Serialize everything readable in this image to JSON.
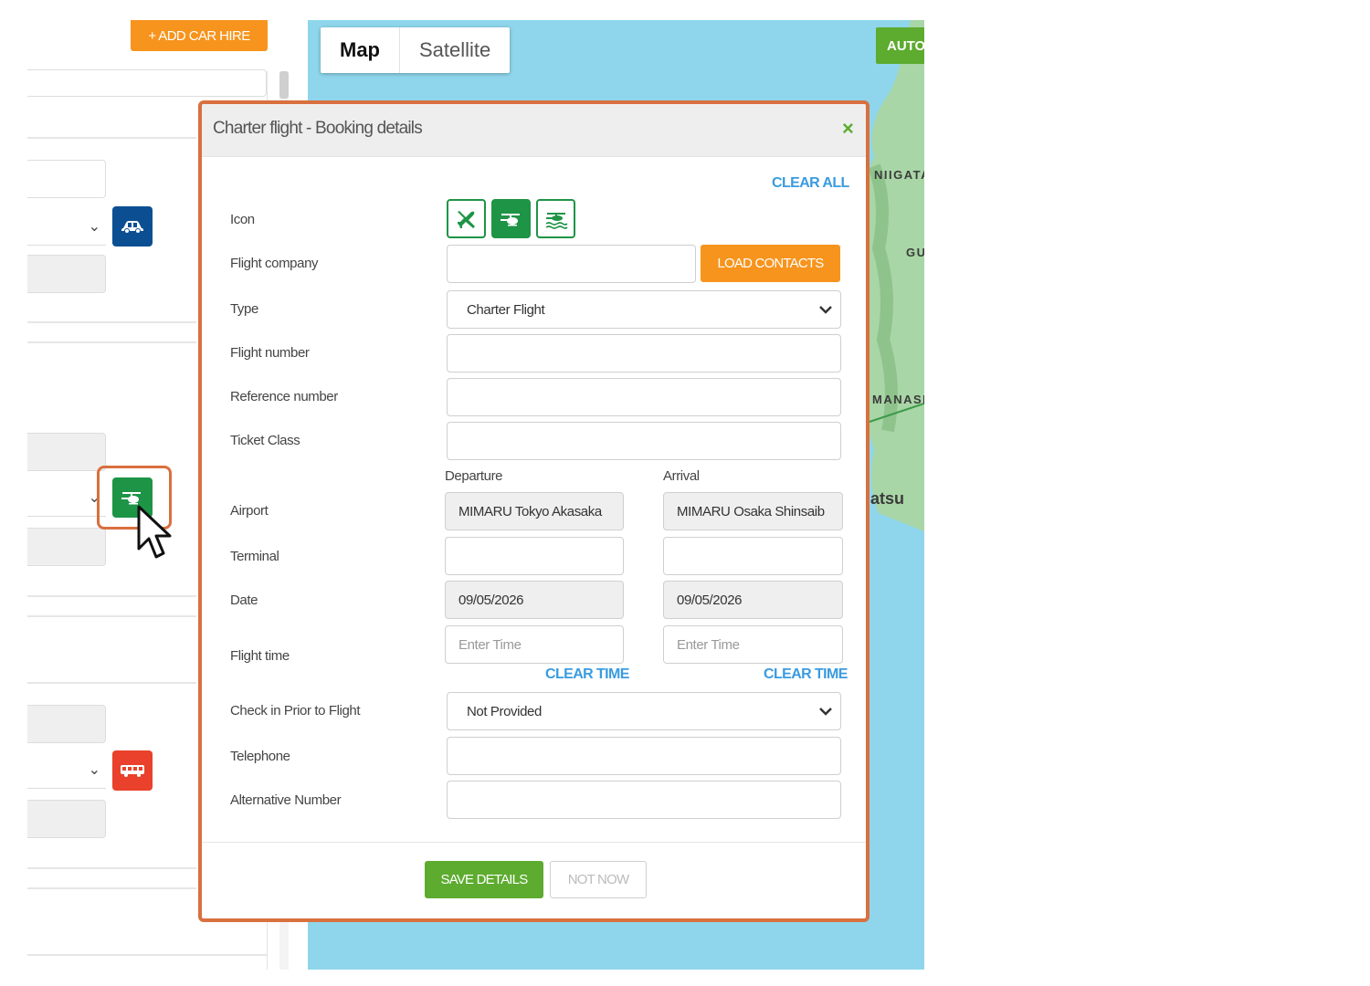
{
  "left_panel": {
    "add_car_hire_label": "+ ADD CAR HIRE"
  },
  "map": {
    "tabs": [
      {
        "label": "Map",
        "active": true
      },
      {
        "label": "Satellite",
        "active": false
      }
    ],
    "auto_button_label": "AUTO",
    "place_labels": [
      "NIIGATA",
      "GU",
      "MANASI",
      "atsu"
    ]
  },
  "modal": {
    "title": "Charter flight - Booking details",
    "close_symbol": "×",
    "clear_all_label": "CLEAR ALL",
    "icon_label": "Icon",
    "icon_options": [
      {
        "name": "airplane-icon",
        "selected": false
      },
      {
        "name": "helicopter-icon",
        "selected": true
      },
      {
        "name": "seaplane-icon",
        "selected": false
      }
    ],
    "flight_company": {
      "label": "Flight company",
      "value": ""
    },
    "load_contacts_label": "LOAD CONTACTS",
    "type": {
      "label": "Type",
      "value": "Charter Flight"
    },
    "flight_number": {
      "label": "Flight number",
      "value": ""
    },
    "reference_number": {
      "label": "Reference number",
      "value": ""
    },
    "ticket_class": {
      "label": "Ticket Class",
      "value": ""
    },
    "departure_heading": "Departure",
    "arrival_heading": "Arrival",
    "airport": {
      "label": "Airport",
      "departure": "MIMARU Tokyo Akasaka",
      "arrival": "MIMARU Osaka Shinsaib"
    },
    "terminal": {
      "label": "Terminal",
      "departure": "",
      "arrival": ""
    },
    "date": {
      "label": "Date",
      "departure": "09/05/2026",
      "arrival": "09/05/2026"
    },
    "flight_time": {
      "label": "Flight time",
      "placeholder": "Enter Time",
      "clear_label": "CLEAR TIME"
    },
    "check_in": {
      "label": "Check in Prior to Flight",
      "value": "Not Provided"
    },
    "telephone": {
      "label": "Telephone",
      "value": ""
    },
    "alternative_number": {
      "label": "Alternative Number",
      "value": ""
    },
    "save_label": "SAVE DETAILS",
    "not_now_label": "NOT NOW"
  },
  "colors": {
    "accent_orange": "#f7941d",
    "accent_green": "#5dab2f",
    "icon_green": "#1e9446",
    "link_blue": "#3a9be0",
    "highlight_ring": "#d9703f",
    "car_blue": "#0b4f92",
    "bus_red": "#e9412b"
  }
}
